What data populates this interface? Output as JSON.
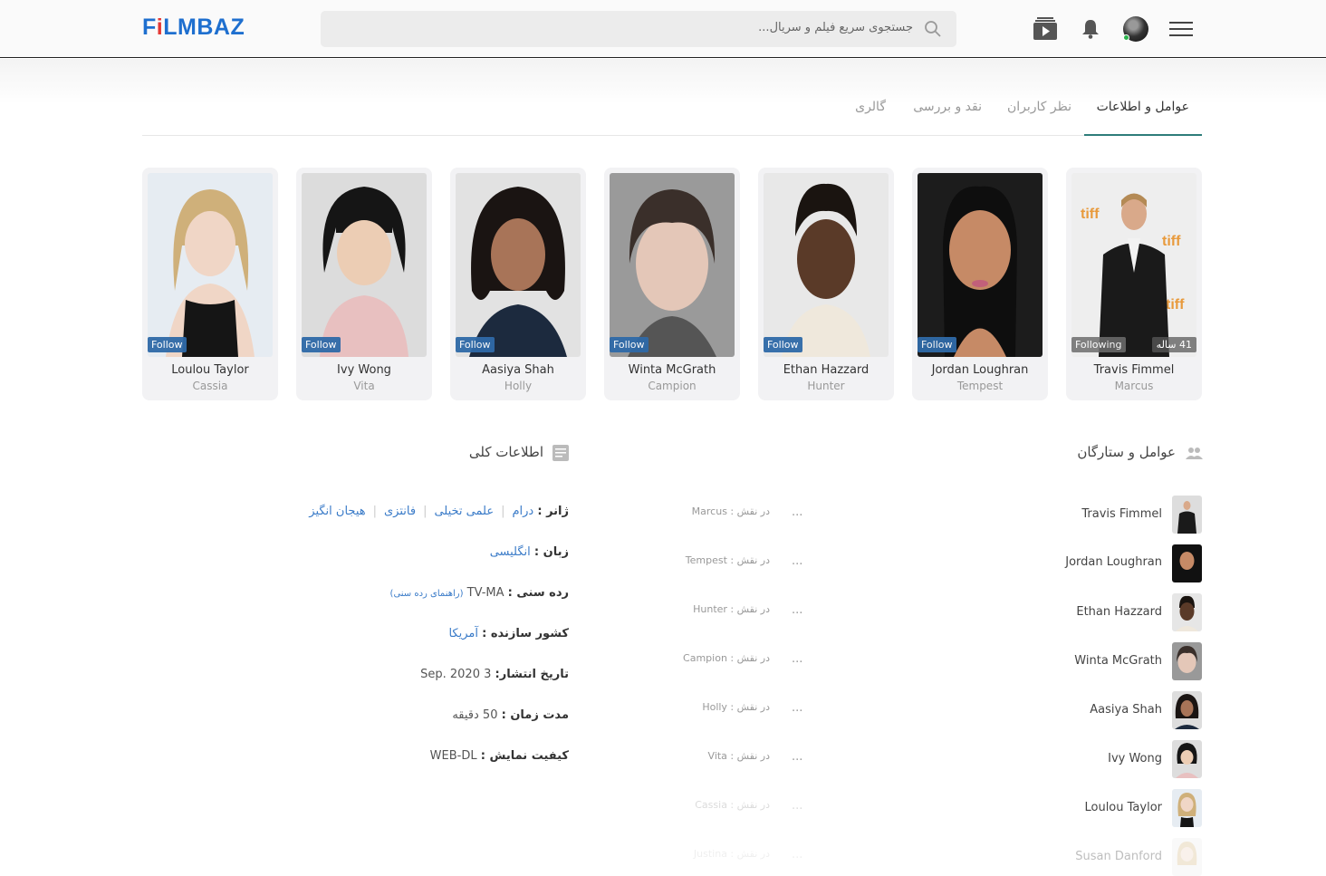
{
  "header": {
    "logo": {
      "text_left": "F",
      "text_i": "i",
      "text_right": "LMBAZ"
    },
    "search": {
      "placeholder": "جستجوی سریع فیلم و سریال..."
    },
    "icons": [
      "menu-icon",
      "avatar",
      "bell-icon",
      "video-library-icon",
      "search-icon"
    ]
  },
  "tabs": [
    {
      "label": "عوامل و اطلاعات",
      "active": true
    },
    {
      "label": "نظر کاربران"
    },
    {
      "label": "نقد و بررسی"
    },
    {
      "label": "گالری"
    }
  ],
  "cast_cards": [
    {
      "name": "Travis Fimmel",
      "role": "Marcus",
      "button": "Following",
      "age": "41 ساله"
    },
    {
      "name": "Jordan Loughran",
      "role": "Tempest",
      "button": "Follow"
    },
    {
      "name": "Ethan Hazzard",
      "role": "Hunter",
      "button": "Follow"
    },
    {
      "name": "Winta McGrath",
      "role": "Campion",
      "button": "Follow"
    },
    {
      "name": "Aasiya Shah",
      "role": "Holly",
      "button": "Follow"
    },
    {
      "name": "Ivy Wong",
      "role": "Vita",
      "button": "Follow"
    },
    {
      "name": "Loulou Taylor",
      "role": "Cassia",
      "button": "Follow"
    }
  ],
  "cast_section": {
    "title": "عوامل و ستارگان",
    "icon": "people-icon"
  },
  "info_section": {
    "title": "اطلاعات کلی",
    "icon": "document-icon"
  },
  "cast_list": [
    {
      "name": "Travis Fimmel",
      "role_text": "در نقش : Marcus",
      "more": "..."
    },
    {
      "name": "Jordan Loughran",
      "role_text": "در نقش : Tempest",
      "more": "..."
    },
    {
      "name": "Ethan Hazzard",
      "role_text": "در نقش : Hunter",
      "more": "..."
    },
    {
      "name": "Winta McGrath",
      "role_text": "در نقش : Campion",
      "more": "..."
    },
    {
      "name": "Aasiya Shah",
      "role_text": "در نقش : Holly",
      "more": "..."
    },
    {
      "name": "Ivy Wong",
      "role_text": "در نقش : Vita",
      "more": "..."
    },
    {
      "name": "Loulou Taylor",
      "role_text": "در نقش : Cassia",
      "more": "..."
    },
    {
      "name": "Susan Danford",
      "role_text": "در نقش : Justina",
      "more": "..."
    }
  ],
  "info": {
    "genre": {
      "label": "ژانر :",
      "items": [
        "درام",
        "علمی تخیلی",
        "فانتزی",
        "هیجان انگیز"
      ]
    },
    "language": {
      "label": "زبان :",
      "value": "انگلیسی"
    },
    "rating": {
      "label": "رده سنی :",
      "value": "TV-MA",
      "guide": "(راهنمای رده سنی)"
    },
    "country": {
      "label": "کشور سازنده :",
      "value": "آمریکا"
    },
    "release": {
      "label": "تاریخ انتشار:",
      "value": "3 Sep. 2020"
    },
    "duration": {
      "label": "مدت زمان :",
      "value": "50 دقیقه"
    },
    "quality": {
      "label": "کیفیت نمایش :",
      "value": "WEB-DL"
    }
  }
}
